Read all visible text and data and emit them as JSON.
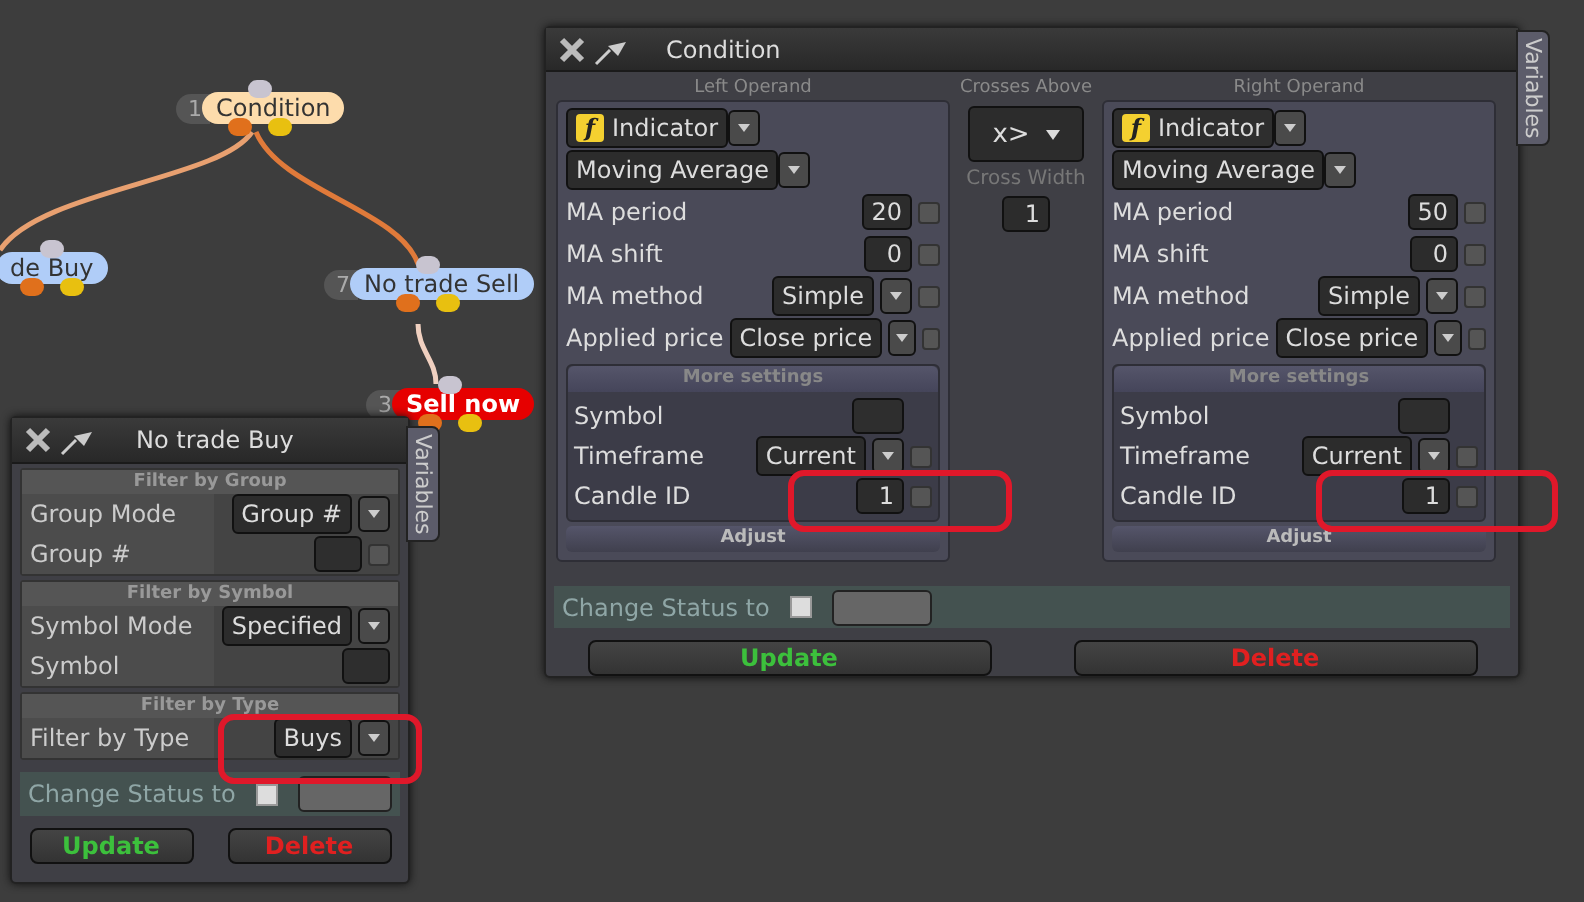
{
  "canvas": {
    "nodes": [
      {
        "number": "1",
        "label": "Condition",
        "kind": "condition"
      },
      {
        "label": "de Buy",
        "kind": "action"
      },
      {
        "number": "7",
        "label": "No trade Sell",
        "kind": "action"
      },
      {
        "number": "3",
        "label": "Sell now",
        "kind": "alert"
      }
    ]
  },
  "condition_window": {
    "title": "Condition",
    "side_tab": "Variables",
    "operands": [
      {
        "caption": "Left Operand",
        "type_icon": "f",
        "type": "Indicator",
        "indicator": "Moving Average",
        "params": [
          {
            "label": "MA period",
            "kind": "number",
            "value": "20",
            "checked": false
          },
          {
            "label": "MA shift",
            "kind": "number",
            "value": "0",
            "checked": false
          },
          {
            "label": "MA method",
            "kind": "select",
            "value": "Simple",
            "checked": false
          },
          {
            "label": "Applied price",
            "kind": "select",
            "value": "Close price",
            "checked": false
          }
        ],
        "more_title": "More settings",
        "more": [
          {
            "label": "Symbol",
            "kind": "text"
          },
          {
            "label": "Timeframe",
            "kind": "select",
            "value": "Current",
            "checked": false
          },
          {
            "label": "Candle ID",
            "kind": "number",
            "value": "1",
            "checked": false
          }
        ],
        "adjust": "Adjust"
      },
      {
        "caption": "Right Operand",
        "type_icon": "f",
        "type": "Indicator",
        "indicator": "Moving Average",
        "params": [
          {
            "label": "MA period",
            "kind": "number",
            "value": "50",
            "checked": false
          },
          {
            "label": "MA shift",
            "kind": "number",
            "value": "0",
            "checked": false
          },
          {
            "label": "MA method",
            "kind": "select",
            "value": "Simple",
            "checked": false
          },
          {
            "label": "Applied price",
            "kind": "select",
            "value": "Close price",
            "checked": false
          }
        ],
        "more_title": "More settings",
        "more": [
          {
            "label": "Symbol",
            "kind": "text"
          },
          {
            "label": "Timeframe",
            "kind": "select",
            "value": "Current",
            "checked": false
          },
          {
            "label": "Candle ID",
            "kind": "number",
            "value": "1",
            "checked": false
          }
        ],
        "adjust": "Adjust"
      }
    ],
    "operator": {
      "caption": "Crosses Above",
      "symbol": "x>",
      "width_label": "Cross Width",
      "width_value": "1"
    },
    "change_status": {
      "label": "Change Status to",
      "checked": false
    },
    "buttons": [
      {
        "label": "Update",
        "kind": "update"
      },
      {
        "label": "Delete",
        "kind": "delete"
      }
    ]
  },
  "filter_window": {
    "title": "No trade Buy",
    "side_tab": "Variables",
    "sections": [
      {
        "title": "Filter by Group",
        "rows": [
          {
            "label": "Group Mode",
            "kind": "select",
            "value": "Group #"
          },
          {
            "label": "Group #",
            "kind": "text",
            "checked": false
          }
        ]
      },
      {
        "title": "Filter by Symbol",
        "rows": [
          {
            "label": "Symbol Mode",
            "kind": "select",
            "value": "Specified"
          },
          {
            "label": "Symbol",
            "kind": "text"
          }
        ]
      },
      {
        "title": "Filter by Type",
        "rows": [
          {
            "label": "Filter by Type",
            "kind": "select",
            "value": "Buys"
          }
        ]
      }
    ],
    "change_status": {
      "label": "Change Status to",
      "checked": false
    },
    "buttons": [
      {
        "label": "Update",
        "kind": "update"
      },
      {
        "label": "Delete",
        "kind": "delete"
      }
    ]
  }
}
